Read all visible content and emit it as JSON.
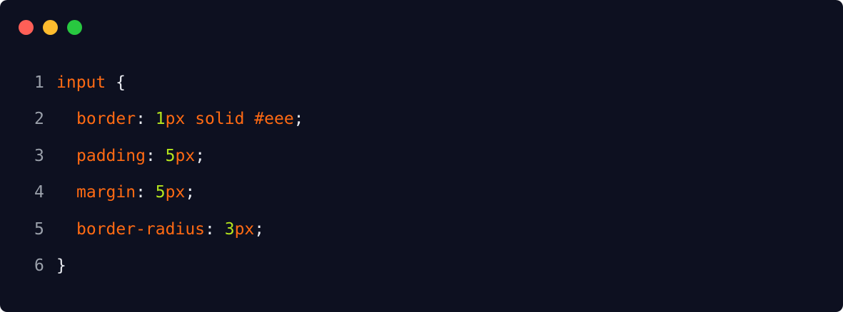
{
  "window": {
    "background": "#0d1020",
    "controls": [
      {
        "name": "close-dot",
        "color": "#ff5f57"
      },
      {
        "name": "minimize-dot",
        "color": "#febc2e"
      },
      {
        "name": "maximize-dot",
        "color": "#28c840"
      }
    ]
  },
  "colors": {
    "keyword": "#ff6a13",
    "punctuation": "#e8eaf0",
    "number": "#b5e61d",
    "line_number": "#9aa0aa"
  },
  "code": {
    "lines": [
      {
        "number": "1",
        "indent": false,
        "tokens": [
          {
            "text": "input",
            "type": "keyword"
          },
          {
            "text": " ",
            "type": "punctuation"
          },
          {
            "text": "{",
            "type": "punctuation"
          }
        ]
      },
      {
        "number": "2",
        "indent": true,
        "tokens": [
          {
            "text": "border",
            "type": "keyword"
          },
          {
            "text": ": ",
            "type": "punctuation"
          },
          {
            "text": "1",
            "type": "number"
          },
          {
            "text": "px solid #eee",
            "type": "keyword"
          },
          {
            "text": ";",
            "type": "punctuation"
          }
        ]
      },
      {
        "number": "3",
        "indent": true,
        "tokens": [
          {
            "text": "padding",
            "type": "keyword"
          },
          {
            "text": ": ",
            "type": "punctuation"
          },
          {
            "text": "5",
            "type": "number"
          },
          {
            "text": "px",
            "type": "keyword"
          },
          {
            "text": ";",
            "type": "punctuation"
          }
        ]
      },
      {
        "number": "4",
        "indent": true,
        "tokens": [
          {
            "text": "margin",
            "type": "keyword"
          },
          {
            "text": ": ",
            "type": "punctuation"
          },
          {
            "text": "5",
            "type": "number"
          },
          {
            "text": "px",
            "type": "keyword"
          },
          {
            "text": ";",
            "type": "punctuation"
          }
        ]
      },
      {
        "number": "5",
        "indent": true,
        "tokens": [
          {
            "text": "border-radius",
            "type": "keyword"
          },
          {
            "text": ": ",
            "type": "punctuation"
          },
          {
            "text": "3",
            "type": "number"
          },
          {
            "text": "px",
            "type": "keyword"
          },
          {
            "text": ";",
            "type": "punctuation"
          }
        ]
      },
      {
        "number": "6",
        "indent": false,
        "tokens": [
          {
            "text": "}",
            "type": "punctuation"
          }
        ]
      }
    ]
  }
}
